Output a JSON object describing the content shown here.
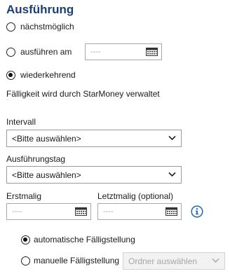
{
  "section": {
    "title": "Ausführung"
  },
  "options": {
    "asap": {
      "label": "nächstmöglich",
      "checked": false
    },
    "execute_on": {
      "label": "ausführen am",
      "checked": false,
      "date_placeholder": "----"
    },
    "recurring": {
      "label": "wiederkehrend",
      "checked": true
    }
  },
  "recurring_info": {
    "text": "Fälligkeit wird durch StarMoney verwaltet"
  },
  "interval": {
    "label": "Intervall",
    "value": "<Bitte auswählen>"
  },
  "execution_day": {
    "label": "Ausführungstag",
    "value": "<Bitte auswählen>"
  },
  "first_date": {
    "label": "Erstmalig",
    "placeholder": "----"
  },
  "last_date": {
    "label": "Letztmalig (optional)",
    "placeholder": "----"
  },
  "due_mode": {
    "automatic": {
      "label": "automatische Fälligstellung",
      "checked": true
    },
    "manual": {
      "label": "manuelle Fälligstellung",
      "checked": false
    },
    "folder_select": {
      "value": "Ordner auswählen",
      "disabled": true
    }
  },
  "icons": {
    "calendar": "calendar-icon",
    "chevron": "chevron-down-icon",
    "info": "info-icon"
  },
  "colors": {
    "title": "#1c3f73",
    "info_icon": "#2a6fb0",
    "disabled_bg": "#f2f2f2"
  }
}
